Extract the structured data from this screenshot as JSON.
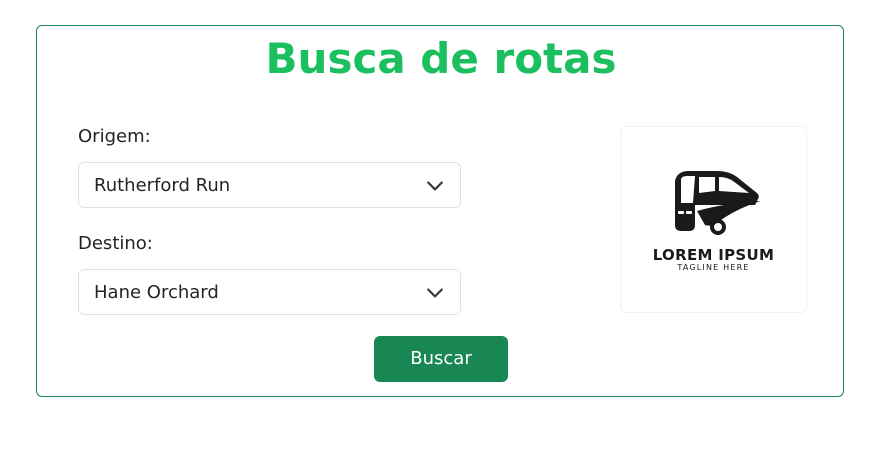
{
  "title": "Busca de rotas",
  "form": {
    "origem_label": "Origem:",
    "origem_value": "Rutherford Run",
    "destino_label": "Destino:",
    "destino_value": "Hane Orchard",
    "submit_label": "Buscar"
  },
  "logo": {
    "name": "LOREM IPSUM",
    "tagline": "TAGLINE HERE",
    "icon": "bus-icon"
  },
  "colors": {
    "accent": "#1bbf5f",
    "button": "#198754",
    "border": "#198754"
  }
}
